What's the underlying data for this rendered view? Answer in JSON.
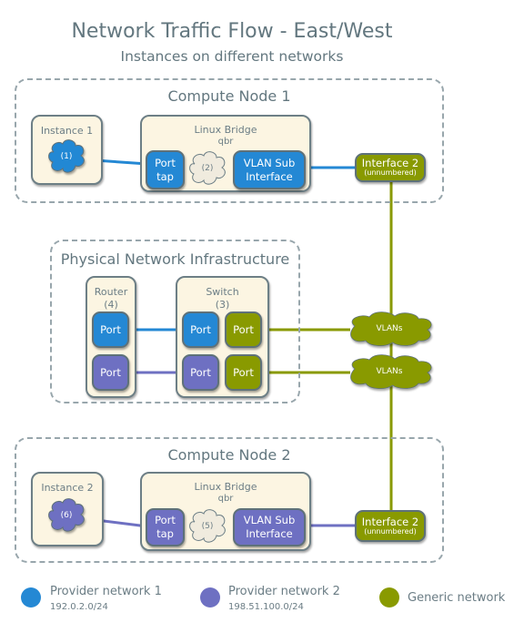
{
  "header": {
    "title": "Network Traffic Flow - East/West",
    "subtitle": "Instances on different networks"
  },
  "colors": {
    "provider1": "#2488d4",
    "provider2": "#6e70c2",
    "generic": "#899a00",
    "box_fill": "#fcf5e2",
    "cloud_fill": "#f0ebde",
    "region_border": "#98a6ac"
  },
  "compute_node_1": {
    "label": "Compute Node 1",
    "instance": {
      "label": "Instance 1",
      "cloud": "(1)"
    },
    "bridge": {
      "label": "Linux Bridge",
      "sublabel": "qbr",
      "port_line1": "Port",
      "port_line2": "tap",
      "cloud": "(2)",
      "vlan_line1": "VLAN Sub",
      "vlan_line2": "Interface"
    },
    "interface": {
      "label": "Interface 2",
      "sublabel": "(unnumbered)"
    }
  },
  "physical": {
    "label": "Physical Network Infrastructure",
    "router": {
      "label": "Router",
      "number": "(4)",
      "ports": [
        "Port",
        "Port"
      ]
    },
    "switch": {
      "label": "Switch",
      "number": "(3)",
      "ports": [
        "Port",
        "Port",
        "Port",
        "Port"
      ]
    },
    "vlans": [
      "VLANs",
      "VLANs"
    ]
  },
  "compute_node_2": {
    "label": "Compute Node 2",
    "instance": {
      "label": "Instance 2",
      "cloud": "(6)"
    },
    "bridge": {
      "label": "Linux Bridge",
      "sublabel": "qbr",
      "port_line1": "Port",
      "port_line2": "tap",
      "cloud": "(5)",
      "vlan_line1": "VLAN Sub",
      "vlan_line2": "Interface"
    },
    "interface": {
      "label": "Interface 2",
      "sublabel": "(unnumbered)"
    }
  },
  "legend": [
    {
      "name": "Provider network 1",
      "subnet": "192.0.2.0/24"
    },
    {
      "name": "Provider network 2",
      "subnet": "198.51.100.0/24"
    },
    {
      "name": "Generic network",
      "subnet": ""
    }
  ]
}
